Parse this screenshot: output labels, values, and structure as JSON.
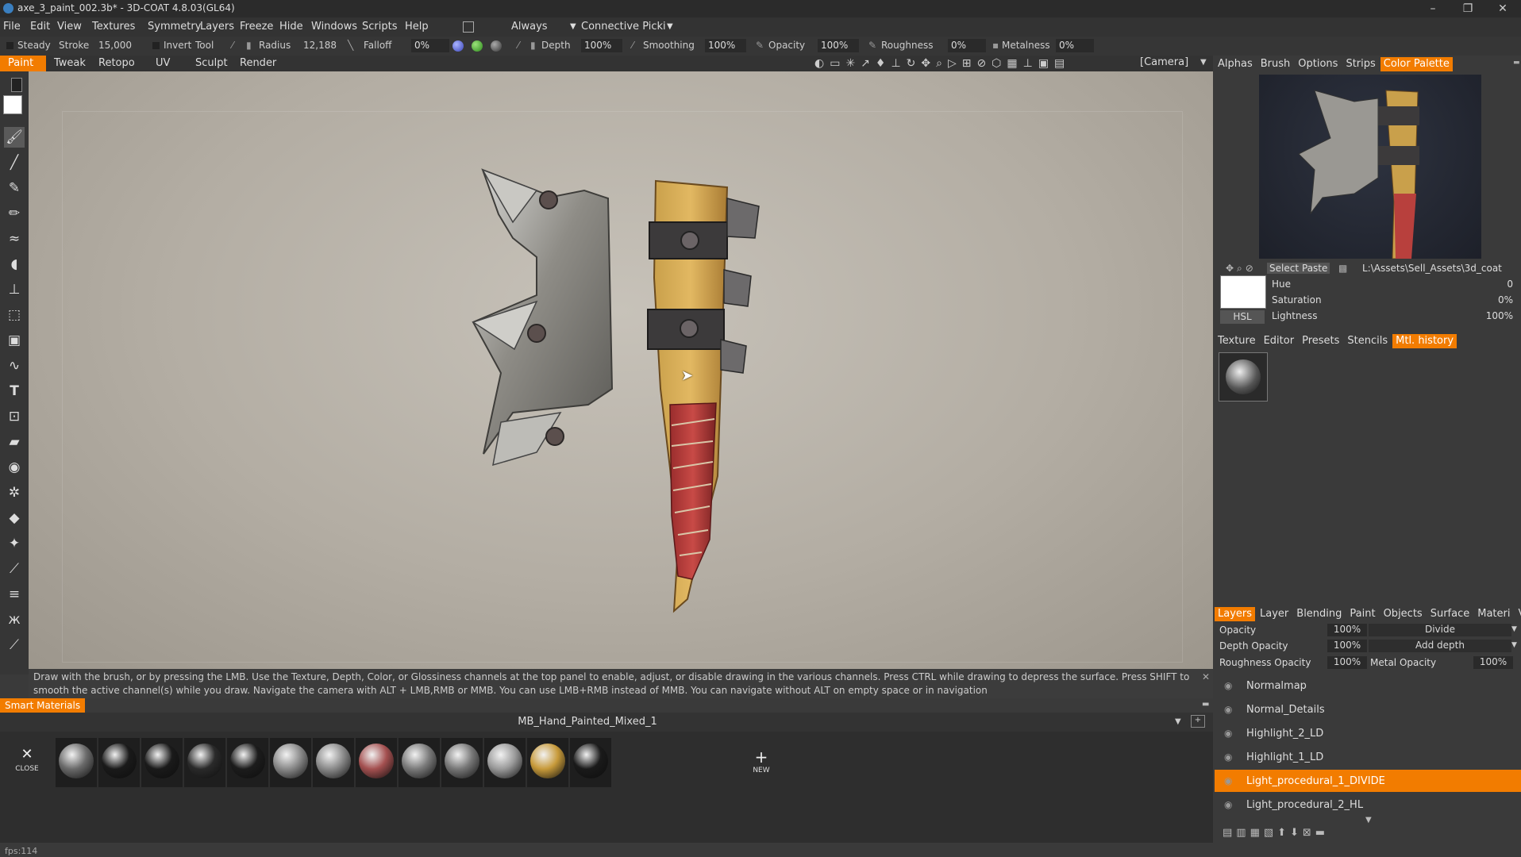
{
  "window": {
    "title": "axe_3_paint_002.3b* - 3D-COAT 4.8.03(GL64)",
    "minimize": "–",
    "maximize": "❐",
    "close": "✕"
  },
  "menu": [
    "File",
    "Edit",
    "View",
    "Textures",
    "Symmetry",
    "Layers",
    "Freeze",
    "Hide",
    "Windows",
    "Scripts",
    "Help"
  ],
  "menu_extra": {
    "always": "Always",
    "connective": "Connective Picki"
  },
  "brushbar": {
    "steady": "Steady",
    "stroke_label": "Stroke",
    "stroke_val": "15,000",
    "invert": "Invert",
    "tool": "Tool",
    "radius_label": "Radius",
    "radius_val": "12,188",
    "falloff_label": "Falloff",
    "falloff_val": "0%",
    "depth_label": "Depth",
    "depth_val": "100%",
    "smoothing_label": "Smoothing",
    "smoothing_val": "100%",
    "opacity_label": "Opacity",
    "opacity_val": "100%",
    "roughness_label": "Roughness",
    "roughness_val": "0%",
    "metalness_label": "Metalness",
    "metalness_val": "0%"
  },
  "modes": [
    "Paint",
    "Tweak",
    "Retopo",
    "UV",
    "Sculpt",
    "Render"
  ],
  "camera": "[Camera]",
  "hint": "Draw with the brush, or by pressing the LMB. Use the Texture, Depth, Color, or Glossiness channels at the top panel to enable, adjust, or disable drawing in the various channels. Press CTRL while drawing to depress the surface. Press SHIFT to smooth the active channel(s) while you draw. Navigate the camera with ALT + LMB,RMB or MMB. You can use LMB+RMB instead of MMB. You can navigate without ALT on empty space or in navigation",
  "smart_materials": {
    "tab": "Smart Materials",
    "current": "MB_Hand_Painted_Mixed_1",
    "close": "CLOSE",
    "new": "NEW",
    "ball_colors": [
      "#6a6a6a",
      "#1a1a1a",
      "#1a1a1a",
      "#2a2a2a",
      "#1c1c1c",
      "#8a8a8a",
      "#8a8a8a",
      "#a45050",
      "#7a7a7a",
      "#777777",
      "#9a9a9a",
      "#c79a3a",
      "#1a1a1a"
    ]
  },
  "fps": "fps:114",
  "right_tabs_top": [
    {
      "label": "Alphas",
      "active": false
    },
    {
      "label": "Brush",
      "active": false
    },
    {
      "label": "Options",
      "active": false
    },
    {
      "label": "Strips",
      "active": false
    },
    {
      "label": "Color Palette",
      "active": true
    }
  ],
  "palette": {
    "select": "Select",
    "paste": "Paste",
    "path": "L:\\Assets\\Sell_Assets\\3d_coat",
    "hue_label": "Hue",
    "hue_val": "0",
    "sat_label": "Saturation",
    "sat_val": "0%",
    "light_label": "Lightness",
    "light_val": "100%",
    "mode": "HSL"
  },
  "right_tabs_mid": [
    {
      "label": "Texture",
      "active": false
    },
    {
      "label": "Editor",
      "active": false
    },
    {
      "label": "Presets",
      "active": false
    },
    {
      "label": "Stencils",
      "active": false
    },
    {
      "label": "Mtl. history",
      "active": true
    }
  ],
  "right_tabs_bottom": [
    {
      "label": "Layers",
      "active": true
    },
    {
      "label": "Layer",
      "active": false
    },
    {
      "label": "Blending",
      "active": false
    },
    {
      "label": "Paint",
      "active": false
    },
    {
      "label": "Objects",
      "active": false
    },
    {
      "label": "Surface",
      "active": false
    },
    {
      "label": "Materi",
      "active": false
    },
    {
      "label": "VoxTree",
      "active": false
    }
  ],
  "layer_props": {
    "opacity_label": "Opacity",
    "opacity_val": "100%",
    "blend": "Divide",
    "depth_op_label": "Depth Opacity",
    "depth_op_val": "100%",
    "add_depth": "Add depth",
    "rough_op_label": "Roughness Opacity",
    "rough_op_val": "100%",
    "metal_op_label": "Metal Opacity",
    "metal_op_val": "100%"
  },
  "layers": [
    {
      "name": "Normalmap",
      "active": false
    },
    {
      "name": "Normal_Details",
      "active": false
    },
    {
      "name": "Highlight_2_LD",
      "active": false
    },
    {
      "name": "Highlight_1_LD",
      "active": false
    },
    {
      "name": "Light_procedural_1_DIVIDE",
      "active": true
    },
    {
      "name": "Light_procedural_2_HL",
      "active": false
    }
  ],
  "icons": {
    "eye": "👁"
  }
}
